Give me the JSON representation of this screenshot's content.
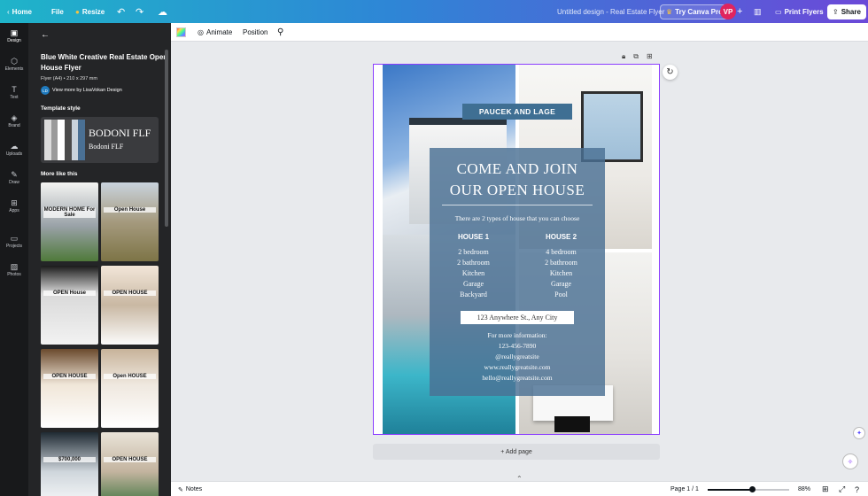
{
  "topbar": {
    "home": "Home",
    "file": "File",
    "resize": "Resize",
    "doc_title": "Untitled design - Real Estate Flyer",
    "try_pro": "Try Canva Pro",
    "avatar": "VP",
    "print": "Print Flyers",
    "share": "Share"
  },
  "rail": [
    "Design",
    "Elements",
    "Text",
    "Brand",
    "Uploads",
    "Draw",
    "Apps",
    "Projects",
    "Photos"
  ],
  "panel": {
    "title_line1": "Blue White Creative Real Estate Open",
    "title_line2": "House Flyer",
    "meta": "Flyer (A4) • 210 x 297 mm",
    "author_initials": "LD",
    "author": "View more by LisaVokan Design",
    "template_style": "Template style",
    "font_big": "BODONI FLF",
    "font_small": "Bodoni FLF",
    "more_like": "More like this",
    "thumbs": [
      {
        "text": "MODERN HOME For Sale"
      },
      {
        "text": "Open House"
      },
      {
        "text": "OPEN House"
      },
      {
        "text": "OPEN HOUSE"
      },
      {
        "text": "OPEN HOUSE"
      },
      {
        "text": "Open HOUSE"
      },
      {
        "text": "$700,000"
      },
      {
        "text": "OPEN HOUSE"
      }
    ]
  },
  "toolbar": {
    "animate": "Animate",
    "position": "Position"
  },
  "flyer": {
    "ribbon": "PAUCEK AND LAGE",
    "headline1": "COME AND JOIN",
    "headline2": "OUR OPEN HOUSE",
    "sub": "There are 2 types of house that you can choose",
    "house1": "HOUSE 1",
    "house1_items": [
      "2 bedroom",
      "2 bathroom",
      "Kitchen",
      "Garage",
      "Backyard"
    ],
    "house2": "HOUSE 2",
    "house2_items": [
      "4 bedroom",
      "2 bathroom",
      "Kitchen",
      "Garage",
      "Pool"
    ],
    "address": "123 Anywhere St., Any City",
    "info": "For more information:",
    "phone": "123-456-7890",
    "handle": "@reallygreatsite",
    "web": "www.reallygreatsite.com",
    "email": "hello@reallygreatsite.com"
  },
  "add_page": "+ Add page",
  "bottombar": {
    "notes": "Notes",
    "page": "Page 1 / 1",
    "zoom": "88%"
  },
  "colors": {
    "accent": "#8b3dff",
    "panel_bg": "#242527",
    "flyer_blue": "#4a7094"
  }
}
